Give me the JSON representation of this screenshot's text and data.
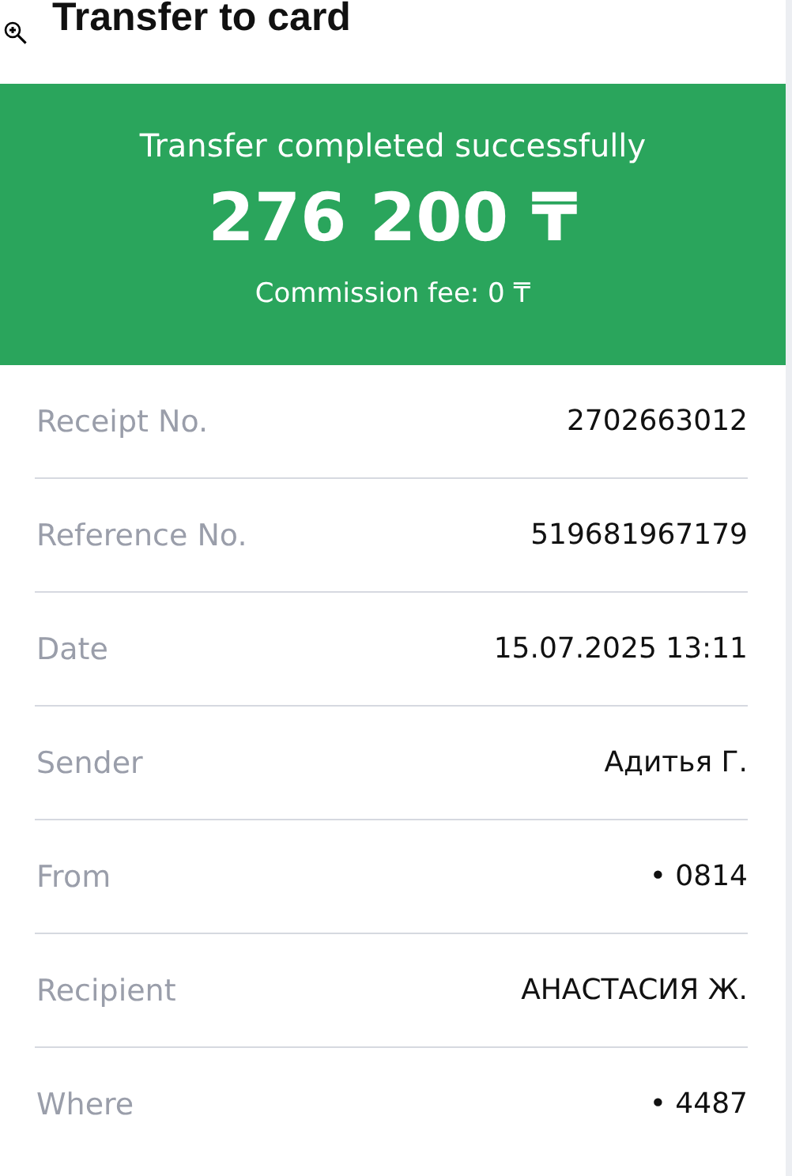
{
  "header": {
    "title": "Transfer to card"
  },
  "banner": {
    "status": "Transfer completed successfully",
    "amount": "276 200 ₸",
    "commission": "Commission fee: 0 ₸"
  },
  "details": [
    {
      "label": "Receipt No.",
      "value": "2702663012"
    },
    {
      "label": "Reference No.",
      "value": "519681967179"
    },
    {
      "label": "Date",
      "value": "15.07.2025 13:11"
    },
    {
      "label": "Sender",
      "value": "Адитья Г."
    },
    {
      "label": "From",
      "value": "• 0814"
    },
    {
      "label": "Recipient",
      "value": "АНАСТАСИЯ Ж."
    },
    {
      "label": "Where",
      "value": "• 4487"
    }
  ]
}
